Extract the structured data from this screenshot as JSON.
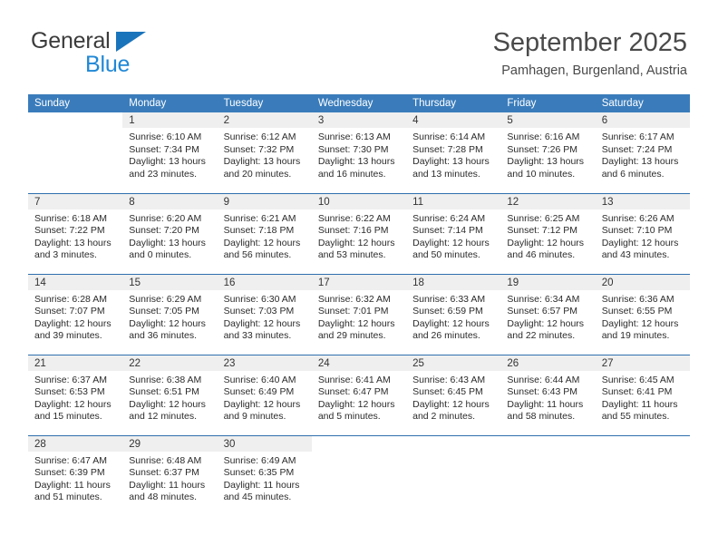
{
  "brand": {
    "name_top": "General",
    "name_bottom": "Blue",
    "accent_color": "#2088d6",
    "triangle_color": "#1a74bb"
  },
  "header": {
    "title": "September 2025",
    "subtitle": "Pamhagen, Burgenland, Austria"
  },
  "theme": {
    "header_row_bg": "#3a7cbb",
    "daynum_band_bg": "#efefef",
    "week_separator": "#2f6fae",
    "text_color": "#2b2b2b"
  },
  "calendar": {
    "weekday_headers": [
      "Sunday",
      "Monday",
      "Tuesday",
      "Wednesday",
      "Thursday",
      "Friday",
      "Saturday"
    ],
    "weeks": [
      [
        {
          "day": "",
          "sunrise": "",
          "sunset": "",
          "daylight_line1": "",
          "daylight_line2": "",
          "empty": true
        },
        {
          "day": "1",
          "sunrise": "Sunrise: 6:10 AM",
          "sunset": "Sunset: 7:34 PM",
          "daylight_line1": "Daylight: 13 hours",
          "daylight_line2": "and 23 minutes."
        },
        {
          "day": "2",
          "sunrise": "Sunrise: 6:12 AM",
          "sunset": "Sunset: 7:32 PM",
          "daylight_line1": "Daylight: 13 hours",
          "daylight_line2": "and 20 minutes."
        },
        {
          "day": "3",
          "sunrise": "Sunrise: 6:13 AM",
          "sunset": "Sunset: 7:30 PM",
          "daylight_line1": "Daylight: 13 hours",
          "daylight_line2": "and 16 minutes."
        },
        {
          "day": "4",
          "sunrise": "Sunrise: 6:14 AM",
          "sunset": "Sunset: 7:28 PM",
          "daylight_line1": "Daylight: 13 hours",
          "daylight_line2": "and 13 minutes."
        },
        {
          "day": "5",
          "sunrise": "Sunrise: 6:16 AM",
          "sunset": "Sunset: 7:26 PM",
          "daylight_line1": "Daylight: 13 hours",
          "daylight_line2": "and 10 minutes."
        },
        {
          "day": "6",
          "sunrise": "Sunrise: 6:17 AM",
          "sunset": "Sunset: 7:24 PM",
          "daylight_line1": "Daylight: 13 hours",
          "daylight_line2": "and 6 minutes."
        }
      ],
      [
        {
          "day": "7",
          "sunrise": "Sunrise: 6:18 AM",
          "sunset": "Sunset: 7:22 PM",
          "daylight_line1": "Daylight: 13 hours",
          "daylight_line2": "and 3 minutes."
        },
        {
          "day": "8",
          "sunrise": "Sunrise: 6:20 AM",
          "sunset": "Sunset: 7:20 PM",
          "daylight_line1": "Daylight: 13 hours",
          "daylight_line2": "and 0 minutes."
        },
        {
          "day": "9",
          "sunrise": "Sunrise: 6:21 AM",
          "sunset": "Sunset: 7:18 PM",
          "daylight_line1": "Daylight: 12 hours",
          "daylight_line2": "and 56 minutes."
        },
        {
          "day": "10",
          "sunrise": "Sunrise: 6:22 AM",
          "sunset": "Sunset: 7:16 PM",
          "daylight_line1": "Daylight: 12 hours",
          "daylight_line2": "and 53 minutes."
        },
        {
          "day": "11",
          "sunrise": "Sunrise: 6:24 AM",
          "sunset": "Sunset: 7:14 PM",
          "daylight_line1": "Daylight: 12 hours",
          "daylight_line2": "and 50 minutes."
        },
        {
          "day": "12",
          "sunrise": "Sunrise: 6:25 AM",
          "sunset": "Sunset: 7:12 PM",
          "daylight_line1": "Daylight: 12 hours",
          "daylight_line2": "and 46 minutes."
        },
        {
          "day": "13",
          "sunrise": "Sunrise: 6:26 AM",
          "sunset": "Sunset: 7:10 PM",
          "daylight_line1": "Daylight: 12 hours",
          "daylight_line2": "and 43 minutes."
        }
      ],
      [
        {
          "day": "14",
          "sunrise": "Sunrise: 6:28 AM",
          "sunset": "Sunset: 7:07 PM",
          "daylight_line1": "Daylight: 12 hours",
          "daylight_line2": "and 39 minutes."
        },
        {
          "day": "15",
          "sunrise": "Sunrise: 6:29 AM",
          "sunset": "Sunset: 7:05 PM",
          "daylight_line1": "Daylight: 12 hours",
          "daylight_line2": "and 36 minutes."
        },
        {
          "day": "16",
          "sunrise": "Sunrise: 6:30 AM",
          "sunset": "Sunset: 7:03 PM",
          "daylight_line1": "Daylight: 12 hours",
          "daylight_line2": "and 33 minutes."
        },
        {
          "day": "17",
          "sunrise": "Sunrise: 6:32 AM",
          "sunset": "Sunset: 7:01 PM",
          "daylight_line1": "Daylight: 12 hours",
          "daylight_line2": "and 29 minutes."
        },
        {
          "day": "18",
          "sunrise": "Sunrise: 6:33 AM",
          "sunset": "Sunset: 6:59 PM",
          "daylight_line1": "Daylight: 12 hours",
          "daylight_line2": "and 26 minutes."
        },
        {
          "day": "19",
          "sunrise": "Sunrise: 6:34 AM",
          "sunset": "Sunset: 6:57 PM",
          "daylight_line1": "Daylight: 12 hours",
          "daylight_line2": "and 22 minutes."
        },
        {
          "day": "20",
          "sunrise": "Sunrise: 6:36 AM",
          "sunset": "Sunset: 6:55 PM",
          "daylight_line1": "Daylight: 12 hours",
          "daylight_line2": "and 19 minutes."
        }
      ],
      [
        {
          "day": "21",
          "sunrise": "Sunrise: 6:37 AM",
          "sunset": "Sunset: 6:53 PM",
          "daylight_line1": "Daylight: 12 hours",
          "daylight_line2": "and 15 minutes."
        },
        {
          "day": "22",
          "sunrise": "Sunrise: 6:38 AM",
          "sunset": "Sunset: 6:51 PM",
          "daylight_line1": "Daylight: 12 hours",
          "daylight_line2": "and 12 minutes."
        },
        {
          "day": "23",
          "sunrise": "Sunrise: 6:40 AM",
          "sunset": "Sunset: 6:49 PM",
          "daylight_line1": "Daylight: 12 hours",
          "daylight_line2": "and 9 minutes."
        },
        {
          "day": "24",
          "sunrise": "Sunrise: 6:41 AM",
          "sunset": "Sunset: 6:47 PM",
          "daylight_line1": "Daylight: 12 hours",
          "daylight_line2": "and 5 minutes."
        },
        {
          "day": "25",
          "sunrise": "Sunrise: 6:43 AM",
          "sunset": "Sunset: 6:45 PM",
          "daylight_line1": "Daylight: 12 hours",
          "daylight_line2": "and 2 minutes."
        },
        {
          "day": "26",
          "sunrise": "Sunrise: 6:44 AM",
          "sunset": "Sunset: 6:43 PM",
          "daylight_line1": "Daylight: 11 hours",
          "daylight_line2": "and 58 minutes."
        },
        {
          "day": "27",
          "sunrise": "Sunrise: 6:45 AM",
          "sunset": "Sunset: 6:41 PM",
          "daylight_line1": "Daylight: 11 hours",
          "daylight_line2": "and 55 minutes."
        }
      ],
      [
        {
          "day": "28",
          "sunrise": "Sunrise: 6:47 AM",
          "sunset": "Sunset: 6:39 PM",
          "daylight_line1": "Daylight: 11 hours",
          "daylight_line2": "and 51 minutes."
        },
        {
          "day": "29",
          "sunrise": "Sunrise: 6:48 AM",
          "sunset": "Sunset: 6:37 PM",
          "daylight_line1": "Daylight: 11 hours",
          "daylight_line2": "and 48 minutes."
        },
        {
          "day": "30",
          "sunrise": "Sunrise: 6:49 AM",
          "sunset": "Sunset: 6:35 PM",
          "daylight_line1": "Daylight: 11 hours",
          "daylight_line2": "and 45 minutes."
        },
        {
          "day": "",
          "sunrise": "",
          "sunset": "",
          "daylight_line1": "",
          "daylight_line2": "",
          "empty": true
        },
        {
          "day": "",
          "sunrise": "",
          "sunset": "",
          "daylight_line1": "",
          "daylight_line2": "",
          "empty": true
        },
        {
          "day": "",
          "sunrise": "",
          "sunset": "",
          "daylight_line1": "",
          "daylight_line2": "",
          "empty": true
        },
        {
          "day": "",
          "sunrise": "",
          "sunset": "",
          "daylight_line1": "",
          "daylight_line2": "",
          "empty": true
        }
      ]
    ]
  }
}
